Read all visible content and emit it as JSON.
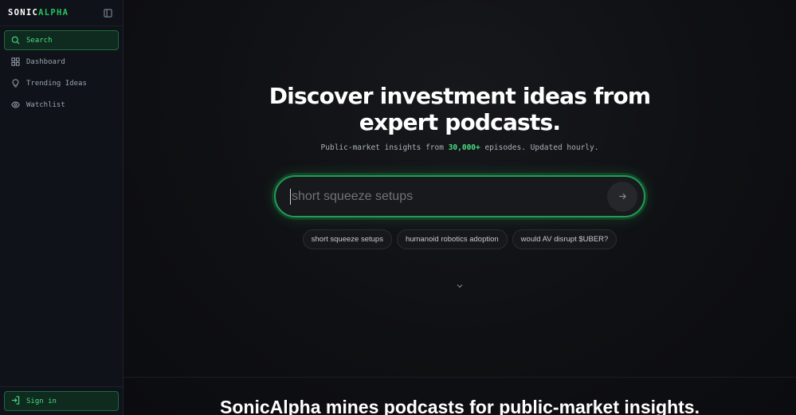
{
  "app": {
    "logo_part1": "SONIC",
    "logo_part2": "ALPHA",
    "accent": "#22c55e"
  },
  "sidebar": {
    "items": [
      {
        "label": "Search",
        "icon": "search-icon",
        "active": true
      },
      {
        "label": "Dashboard",
        "icon": "dashboard-icon",
        "active": false
      },
      {
        "label": "Trending Ideas",
        "icon": "lightbulb-icon",
        "active": false
      },
      {
        "label": "Watchlist",
        "icon": "eye-icon",
        "active": false
      }
    ],
    "signin_label": "Sign in"
  },
  "hero": {
    "title_line1": "Discover investment ideas from",
    "title_line2": "expert podcasts.",
    "subtitle_prefix": "Public-market insights from ",
    "subtitle_highlight": "30,000+",
    "subtitle_suffix": " episodes. Updated hourly."
  },
  "search": {
    "value": "",
    "placeholder": "short squeeze setups"
  },
  "suggestions": [
    "short squeeze setups",
    "humanoid robotics adoption",
    "would AV disrupt $UBER?"
  ],
  "section": {
    "title": "SonicAlpha mines podcasts for public-market insights."
  }
}
